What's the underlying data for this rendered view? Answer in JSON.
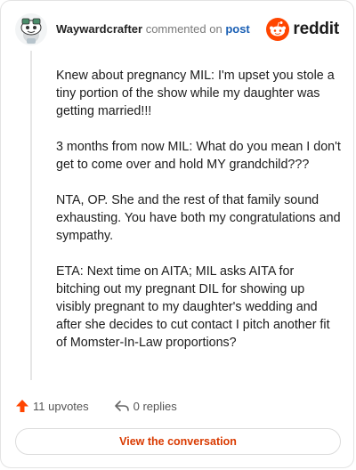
{
  "header": {
    "author": "Waywardcrafter",
    "action": "commented on",
    "link": "post"
  },
  "brand": {
    "name": "reddit"
  },
  "comment": {
    "paragraphs": [
      "Knew about pregnancy MIL: I'm upset you stole a tiny portion of the show while my daughter was getting married!!!",
      "3 months from now MIL: What do you mean I don't get to come over and hold MY grandchild???",
      "NTA, OP. She and the rest of that family sound exhausting. You have both my congratulations and sympathy.",
      "ETA: Next time on AITA; MIL asks AITA for bitching out my pregnant DIL for showing up visibly pregnant to my daughter's wedding and after she decides to cut contact I pitch another fit of Momster-In-Law proportions?"
    ]
  },
  "footer": {
    "upvotes": "11 upvotes",
    "replies": "0 replies",
    "cta": "View the conversation"
  },
  "colors": {
    "accent": "#ff4500",
    "link": "#1a5fb4"
  },
  "icons": {
    "upvote": "arrow-up-icon",
    "reply": "reply-arrow-icon",
    "brand": "reddit-snoo-icon"
  }
}
